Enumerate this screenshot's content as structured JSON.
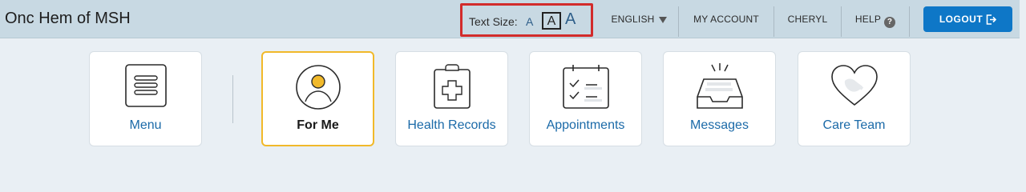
{
  "app": {
    "title": "Onc Hem of MSH"
  },
  "text_size": {
    "label": "Text Size:",
    "small": "A",
    "medium": "A",
    "large": "A"
  },
  "nav": {
    "language": "ENGLISH",
    "my_account": "MY ACCOUNT",
    "user": "CHERYL",
    "help": "HELP",
    "help_icon": "?",
    "logout": "LOGOUT"
  },
  "cards": [
    {
      "label": "Menu",
      "icon": "menu-icon",
      "active": false
    },
    {
      "label": "For Me",
      "icon": "person-icon",
      "active": true
    },
    {
      "label": "Health Records",
      "icon": "clipboard-icon",
      "active": false
    },
    {
      "label": "Appointments",
      "icon": "checklist-icon",
      "active": false
    },
    {
      "label": "Messages",
      "icon": "inbox-icon",
      "active": false
    },
    {
      "label": "Care Team",
      "icon": "heart-icon",
      "active": false
    }
  ],
  "colors": {
    "accent": "#0e77c7",
    "active_border": "#f1b92a",
    "highlight_box": "#d22b2b",
    "link": "#1b6aa8"
  }
}
